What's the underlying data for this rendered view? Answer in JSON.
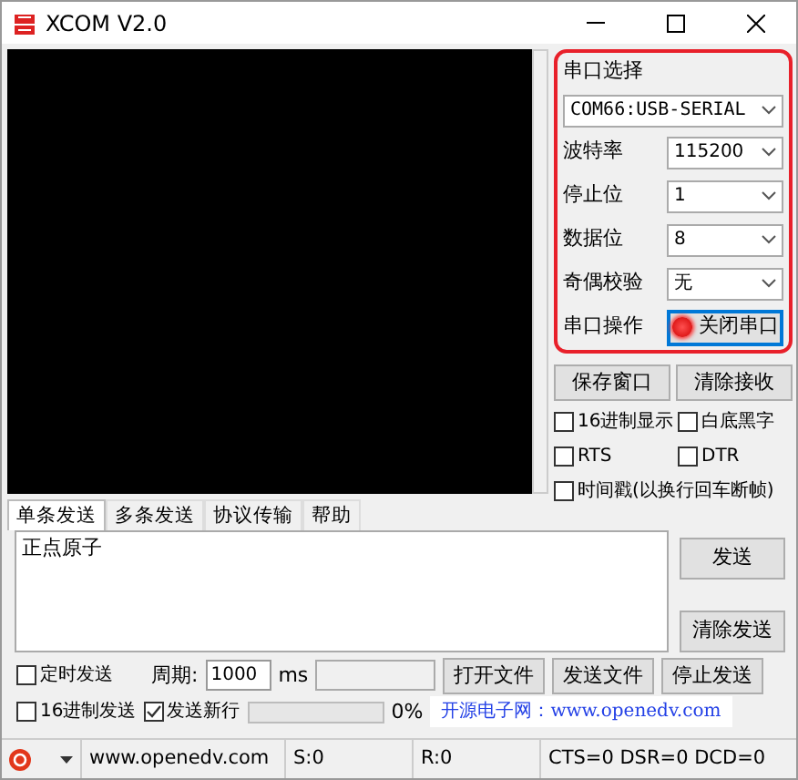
{
  "window": {
    "title": "XCOM V2.0"
  },
  "serial_panel": {
    "title": "串口选择",
    "port": "COM66:USB-SERIAL",
    "fields": [
      {
        "label": "波特率",
        "value": "115200"
      },
      {
        "label": "停止位",
        "value": "1"
      },
      {
        "label": "数据位",
        "value": "8"
      },
      {
        "label": "奇偶校验",
        "value": "无"
      }
    ],
    "operation_label": "串口操作",
    "operation_button": "关闭串口",
    "port_open": true
  },
  "receive_buttons": [
    "保存窗口",
    "清除接收"
  ],
  "option_rows": [
    [
      {
        "label": "16进制显示",
        "checked": false
      },
      {
        "label": "白底黑字",
        "checked": false
      }
    ],
    [
      {
        "label": "RTS",
        "checked": false
      },
      {
        "label": "DTR",
        "checked": false
      }
    ],
    [
      {
        "label": "时间戳(以换行回车断帧)",
        "checked": false
      }
    ]
  ],
  "tabs": [
    {
      "label": "单条发送",
      "selected": true
    },
    {
      "label": "多条发送",
      "selected": false
    },
    {
      "label": "协议传输",
      "selected": false
    },
    {
      "label": "帮助",
      "selected": false
    }
  ],
  "send_text": "正点原子",
  "send_buttons": [
    "发送",
    "清除发送"
  ],
  "timed_send": {
    "label": "定时发送",
    "checked": false
  },
  "period": {
    "label": "周期:",
    "value": "1000",
    "unit": "ms"
  },
  "file_buttons": [
    "打开文件",
    "发送文件",
    "停止发送"
  ],
  "hex_send": {
    "label": "16进制发送",
    "checked": false
  },
  "send_newline": {
    "label": "发送新行",
    "checked": true
  },
  "progress": {
    "level": 0,
    "reading": "0%"
  },
  "site_link": "开源电子网：www.openedv.com",
  "status_bar": [
    "www.openedv.com",
    "S:0",
    "R:0",
    "CTS=0 DSR=0 DCD=0"
  ]
}
